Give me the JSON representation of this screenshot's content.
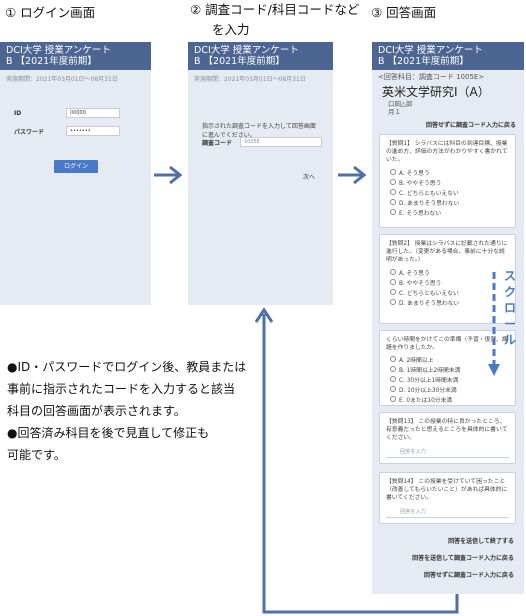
{
  "steps": {
    "one": "① ログイン画面",
    "two_line1": "② 調査コード/科目コードなど",
    "two_line2": "を入力",
    "three": "③ 回答画面"
  },
  "header": {
    "line1": "DCI大学 授業アンケート",
    "line2": "B 【2021年度前期】"
  },
  "period": "実施期間：2021年03月01日～08月31日",
  "login": {
    "id_label": "ID",
    "id_value": "00000",
    "password_label": "パスワード",
    "password_value": "•••••••",
    "login_button": "ログイン"
  },
  "code_entry": {
    "instruction": "指示された調査コードを入力して回答画面に進んでください。",
    "code_label": "調査コード",
    "code_value": "1005E",
    "next_label": "次へ"
  },
  "answer": {
    "course_code": "<回答科目：調査コード 1005E>",
    "course_name": "英米文学研究Ⅰ（A）",
    "teacher": "口岡△郎",
    "day": "月１",
    "return_top": "回答せずに調査コード入力に戻る",
    "q1": "【質問1】 シラバスには科目の到達目標、授業の進め方、評価の方法がわかりやすく書かれていた。",
    "q2": "【質問2】 授業はシラバスに記載された通りに進行した。（変更がある場合、事前に十分な説明があった。）",
    "q3_partial": "くらい時間をかけてこの準備（予習・復習、課題を作りましたか。",
    "likert": [
      "A. そう思う",
      "B. ややそう思う",
      "C. どちらともいえない",
      "D. あまりそう思わない",
      "E. そう思わない"
    ],
    "likert_q2_visible": [
      "A. そう思う",
      "B. ややそう思う",
      "C. どちらともいえない",
      "D. あまりそう思わない"
    ],
    "time_options": [
      "A. 2時間以上",
      "B. 1時間以上2時間未満",
      "C. 30分以上1時間未満",
      "D. 10分以上30分未満",
      "E. 0または10分未満"
    ],
    "q13": "【質問13】 この授業の特に良かったところ、有意義だったと思えるところを具体的に書いてください。",
    "q14": "【質問14】 この授業を受けていて困ったこと（改善してもらいたいこと）があれば具体的に書いてください。",
    "input_placeholder": "回答を入力",
    "submit_end": "回答を送信して終了する",
    "submit_return": "回答を送信して調査コード入力に戻る",
    "return_bottom": "回答せずに調査コード入力に戻る"
  },
  "scroll_label": "スクロール",
  "notes": {
    "n1_line1": "●ID・パスワードでログイン後、教員または",
    "n1_line2": "事前に指示されたコードを入力すると該当",
    "n1_line3": "科目の回答画面が表示されます。",
    "n2_line1": "●回答済み科目を後で見直して修正も",
    "n2_line2": "可能です。"
  },
  "colors": {
    "header": "#4d6593",
    "screen_bg": "#e6eaf2",
    "arrow": "#4f6fa6",
    "button": "#4a79c8"
  }
}
